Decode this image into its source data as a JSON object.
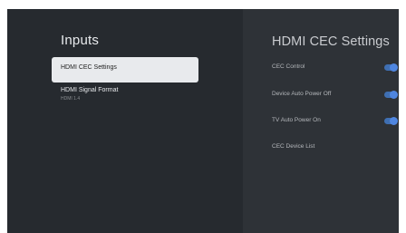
{
  "inputs_panel": {
    "title": "Inputs",
    "items": [
      {
        "label": "HDMI CEC Settings",
        "focused": true
      },
      {
        "label": "HDMI Signal Format",
        "sublabel": "HDMI 1.4"
      }
    ]
  },
  "cec_panel": {
    "title": "HDMI CEC Settings",
    "rows": [
      {
        "label": "CEC Control",
        "toggle_on": true
      },
      {
        "label": "Device Auto Power Off",
        "toggle_on": true
      },
      {
        "label": "TV Auto Power On",
        "toggle_on": true
      },
      {
        "label": "CEC Device List"
      }
    ]
  },
  "colors": {
    "background": "#23272c",
    "focus_highlight": "#e8eaed",
    "toggle_accent": "#4f86e0"
  }
}
